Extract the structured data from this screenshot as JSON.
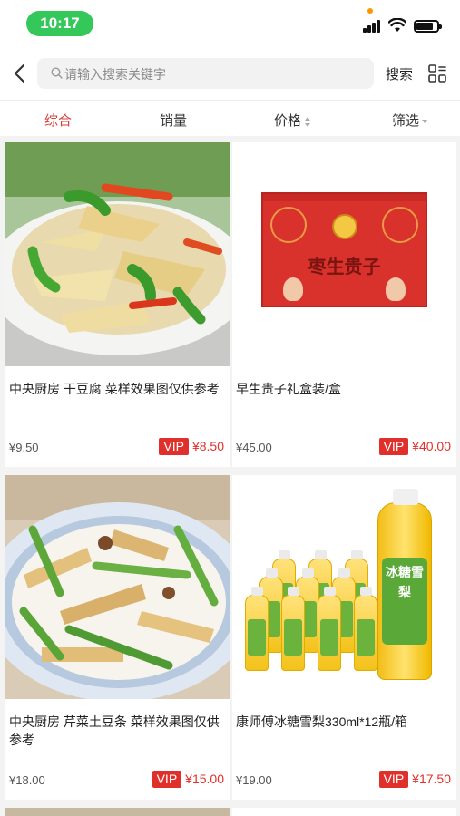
{
  "status_bar": {
    "time": "10:17"
  },
  "header": {
    "search_placeholder": "请输入搜索关键字",
    "search_button": "搜索"
  },
  "sort_tabs": [
    {
      "label": "综合",
      "active": true
    },
    {
      "label": "销量",
      "active": false
    },
    {
      "label": "价格",
      "active": false
    },
    {
      "label": "筛选",
      "active": false
    }
  ],
  "products": [
    {
      "title": "中央厨房  干豆腐 菜样效果图仅供参考",
      "price": "¥9.50",
      "vip_label": "VIP",
      "vip_price": "¥8.50",
      "image": "dried-tofu-dish"
    },
    {
      "title": "早生贵子礼盒装/盒",
      "price": "¥45.00",
      "vip_label": "VIP",
      "vip_price": "¥40.00",
      "image": "gift-box",
      "image_text": "枣生贵子"
    },
    {
      "title": "中央厨房  芹菜土豆条 菜样效果图仅供参考",
      "price": "¥18.00",
      "vip_label": "VIP",
      "vip_price": "¥15.00",
      "image": "celery-potato-dish"
    },
    {
      "title": "康师傅冰糖雪梨330ml*12瓶/箱",
      "price": "¥19.00",
      "vip_label": "VIP",
      "vip_price": "¥17.50",
      "image": "pear-drink-bottles",
      "image_text": "冰糖雪梨"
    }
  ],
  "colors": {
    "accent": "#d8403a",
    "vip": "#e0302b",
    "time_pill": "#34c759"
  }
}
